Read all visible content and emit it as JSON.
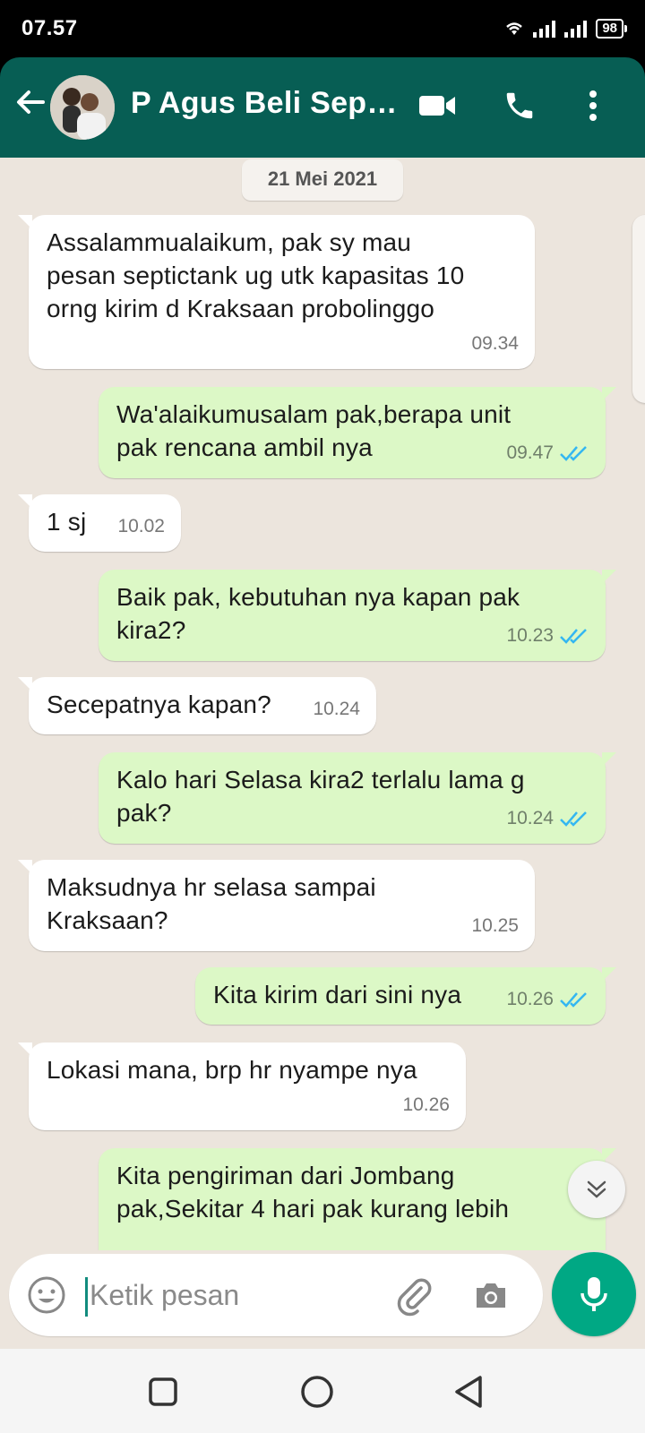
{
  "status_bar": {
    "time": "07.57",
    "battery": "98"
  },
  "header": {
    "contact_name": "P Agus Beli Septi..."
  },
  "chat": {
    "date_label": "21 Mei 2021",
    "messages": [
      {
        "dir": "in",
        "lines": [
          "Assalammualaikum, pak sy mau",
          "pesan septictank ug utk kapasitas 10",
          "orng kirim d Kraksaan probolinggo"
        ],
        "time": "09.34"
      },
      {
        "dir": "out",
        "lines": [
          "Wa'alaikumusalam pak,berapa unit",
          "pak rencana ambil nya"
        ],
        "time": "09.47",
        "read": true
      },
      {
        "dir": "in",
        "lines": [
          "1 sj"
        ],
        "time": "10.02"
      },
      {
        "dir": "out",
        "lines": [
          "Baik pak, kebutuhan nya kapan pak",
          "kira2?"
        ],
        "time": "10.23",
        "read": true
      },
      {
        "dir": "in",
        "lines": [
          "Secepatnya kapan?"
        ],
        "time": "10.24"
      },
      {
        "dir": "out",
        "lines": [
          "Kalo hari Selasa kira2 terlalu lama g",
          "pak?"
        ],
        "time": "10.24",
        "read": true
      },
      {
        "dir": "in",
        "lines": [
          "Maksudnya hr selasa sampai",
          "Kraksaan?"
        ],
        "time": "10.25"
      },
      {
        "dir": "out",
        "lines": [
          "Kita kirim dari sini nya"
        ],
        "time": "10.26",
        "read": true
      },
      {
        "dir": "in",
        "lines": [
          "Lokasi mana, brp hr nyampe nya"
        ],
        "time": "10.26"
      },
      {
        "dir": "out",
        "lines": [
          "Kita pengiriman dari Jombang",
          "pak,Sekitar 4 hari pak kurang lebih"
        ],
        "time": "",
        "read": false
      }
    ]
  },
  "input": {
    "placeholder": "Ketik pesan"
  },
  "icons": {
    "back": "back-arrow-icon",
    "video": "video-call-icon",
    "call": "phone-icon",
    "menu": "more-vert-icon",
    "emoji": "emoji-icon",
    "attach": "paperclip-icon",
    "camera": "camera-icon",
    "mic": "mic-icon",
    "scroll": "chevron-double-down-icon",
    "read_receipt": "double-check-icon"
  },
  "colors": {
    "header": "#075e54",
    "chat_bg": "#ece5dd",
    "outgoing": "#dcf8c6",
    "incoming": "#ffffff",
    "accent": "#00a884",
    "read_tick": "#34b7f1"
  }
}
